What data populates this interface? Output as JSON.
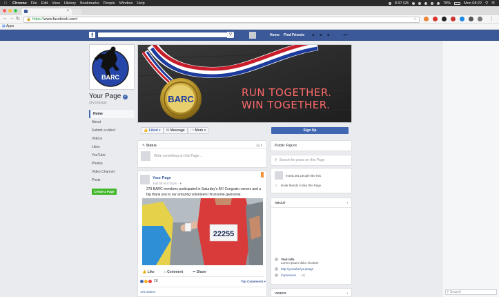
{
  "menubar": {
    "app": "Chrome",
    "items": [
      "File",
      "Edit",
      "View",
      "History",
      "Bookmarks",
      "People",
      "Window",
      "Help"
    ],
    "storage": "8.97 GB",
    "battery": "78%",
    "clock": "Mon 08:22"
  },
  "browser": {
    "url_scheme": "https://",
    "url_host": "www.facebook.com/",
    "bookmarks_label": "Apps"
  },
  "fbnav": {
    "home": "Home",
    "find_friends": "Find Friends"
  },
  "page": {
    "name": "Your Page",
    "handle": "@yourpage",
    "logo_text": "BARC",
    "nav": [
      "Home",
      "About",
      "Submit a video!",
      "Videos",
      "Likes",
      "YouTube",
      "Photos",
      "Video Channel",
      "Posts"
    ],
    "create_page": "Create a Page"
  },
  "cover": {
    "slogan_line1": "RUN TOGETHER.",
    "slogan_line2": "WIN TOGETHER.",
    "medal_text": "BARC"
  },
  "actions": {
    "liked": "Liked",
    "message": "Message",
    "more": "More",
    "signup": "Sign Up"
  },
  "status": {
    "header": "Status",
    "placeholder": "Write something on this Page..."
  },
  "post": {
    "author": "Your Page",
    "date": "July 30 at 6:31pm · ",
    "text": "279 BARC members participated in Saturday's 5K! Congrats runners and a big thank you to our amazing volunteers! #runsome.givesome.",
    "bib": "22255",
    "like": "Like",
    "comment": "Comment",
    "share": "Share",
    "reaction_count": "2K",
    "top_comments": "Top Comments",
    "shares": "175 shares"
  },
  "right": {
    "category": "Public Figure",
    "search_placeholder": "Search for posts on this Page",
    "likes_text": "9,658,301 people like this",
    "invite_text": "Invite friends to like this Page",
    "about_header": "ABOUT",
    "about_items": [
      "Your info",
      "Lorem ipsum dolor sit amet",
      "http://youtube/yourpage",
      "Impressum",
      "(4)"
    ],
    "videos_header": "VIDEOS"
  },
  "gutter": {
    "search_placeholder": "Search"
  }
}
